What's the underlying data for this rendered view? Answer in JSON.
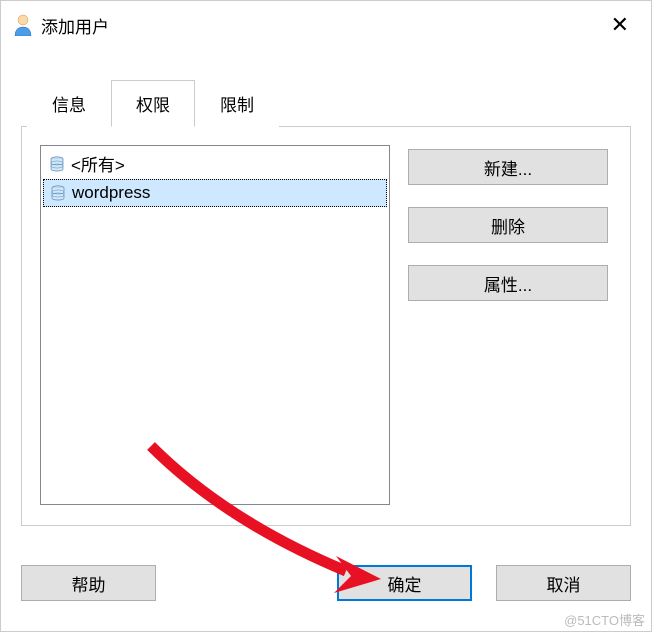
{
  "dialog": {
    "title": "添加用户"
  },
  "tabs": {
    "info": "信息",
    "permissions": "权限",
    "limits": "限制"
  },
  "list": {
    "all": "<所有>",
    "item1": "wordpress"
  },
  "buttons": {
    "new": "新建...",
    "delete": "删除",
    "properties": "属性...",
    "help": "帮助",
    "ok": "确定",
    "cancel": "取消"
  },
  "watermark": "@51CTO博客"
}
